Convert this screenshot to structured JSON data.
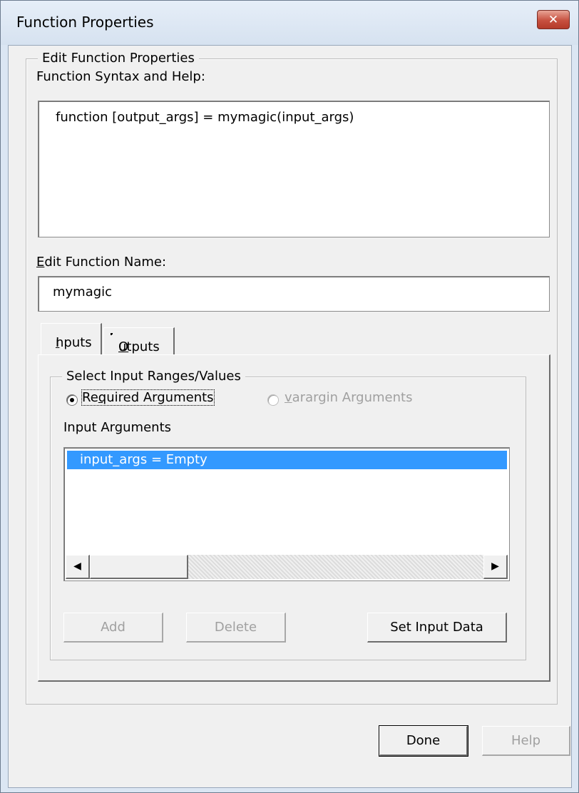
{
  "window": {
    "title": "Function Properties",
    "close_glyph": "✕"
  },
  "edit_group": {
    "legend": "Edit Function Properties",
    "syntax_label": "Function Syntax and Help:",
    "syntax_text": "function [output_args] = mymagic(input_args)",
    "name_label_access": "E",
    "name_label_rest": "dit Function Name:",
    "name_value": "mymagic"
  },
  "tabs": {
    "inputs_access": "I",
    "inputs_rest": "nputs",
    "outputs_access": "O",
    "outputs_rest": "utputs",
    "selected": "Inputs"
  },
  "input_group": {
    "legend": "Select Input Ranges/Values",
    "radio_required_pre": "Re",
    "radio_required_access": "q",
    "radio_required_post": "uired Arguments",
    "radio_required_checked": true,
    "radio_varargin_access": "v",
    "radio_varargin_rest": "arargin Arguments",
    "radio_varargin_enabled": false,
    "list_label": "Input Arguments",
    "list_items": [
      "input_args = Empty"
    ],
    "selected_index": 0
  },
  "buttons": {
    "add": "Add",
    "delete": "Delete",
    "set_input_data": "Set Input Data",
    "done": "Done",
    "help": "Help"
  },
  "icons": {
    "scroll_left": "◀",
    "scroll_right": "▶"
  },
  "colors": {
    "selection": "#3399ff",
    "close_button": "#c7503f"
  }
}
